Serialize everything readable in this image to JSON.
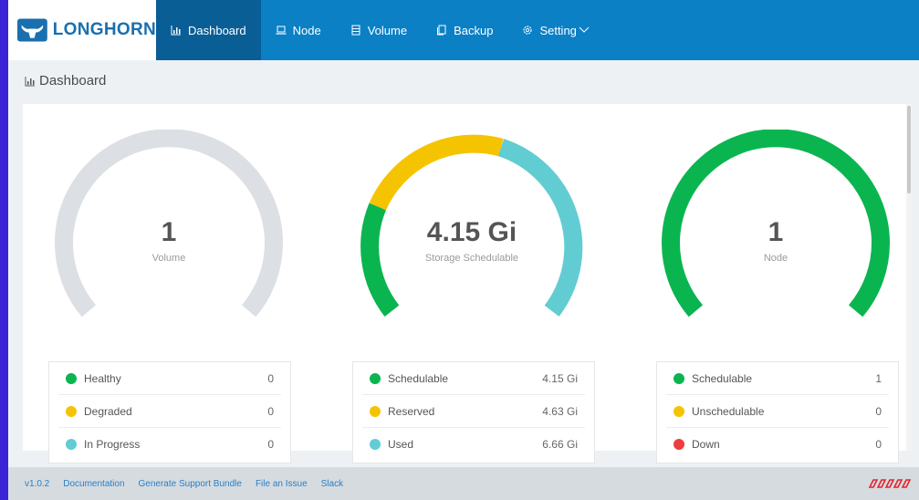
{
  "app": {
    "name": "LONGHORN"
  },
  "nav": [
    {
      "label": "Dashboard",
      "icon": "bar-chart-icon",
      "active": true
    },
    {
      "label": "Node",
      "icon": "laptop-icon"
    },
    {
      "label": "Volume",
      "icon": "database-icon"
    },
    {
      "label": "Backup",
      "icon": "copy-icon"
    },
    {
      "label": "Setting",
      "icon": "gear-icon"
    }
  ],
  "page": {
    "title": "Dashboard"
  },
  "colors": {
    "header": "#0b80c5",
    "nav_active": "#0a5e96",
    "green": "#0ab550",
    "yellow": "#f5c400",
    "cyan": "#62ccd3",
    "gray": "#dcdfe3",
    "red": "#ee3d3d"
  },
  "gauges": [
    {
      "value": "1",
      "label": "Volume",
      "legend": [
        {
          "label": "Healthy",
          "value": "0",
          "color": "green"
        },
        {
          "label": "Degraded",
          "value": "0",
          "color": "yellow"
        },
        {
          "label": "In Progress",
          "value": "0",
          "color": "cyan"
        }
      ]
    },
    {
      "value": "4.15 Gi",
      "label": "Storage Schedulable",
      "legend": [
        {
          "label": "Schedulable",
          "value": "4.15 Gi",
          "color": "green"
        },
        {
          "label": "Reserved",
          "value": "4.63 Gi",
          "color": "yellow"
        },
        {
          "label": "Used",
          "value": "6.66 Gi",
          "color": "cyan"
        }
      ]
    },
    {
      "value": "1",
      "label": "Node",
      "legend": [
        {
          "label": "Schedulable",
          "value": "1",
          "color": "green"
        },
        {
          "label": "Unschedulable",
          "value": "0",
          "color": "yellow"
        },
        {
          "label": "Down",
          "value": "0",
          "color": "red"
        }
      ]
    }
  ],
  "footer": {
    "links": [
      "v1.0.2",
      "Documentation",
      "Generate Support Bundle",
      "File an Issue",
      "Slack"
    ]
  }
}
